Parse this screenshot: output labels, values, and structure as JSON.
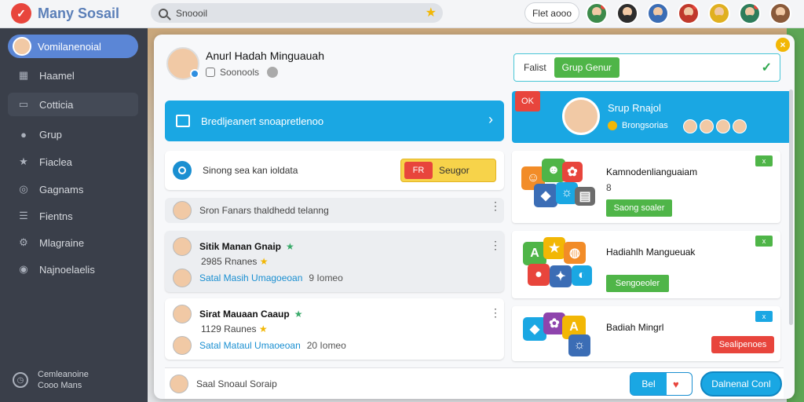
{
  "app": {
    "title": "Many Sosail"
  },
  "search": {
    "value": "Snoooil"
  },
  "top": {
    "button_label": "Flet aooo"
  },
  "sidebar": {
    "items": [
      {
        "label": "Vomilanenoial"
      },
      {
        "label": "Haamel"
      },
      {
        "label": "Cotticia"
      },
      {
        "label": "Grup"
      },
      {
        "label": "Fiaclea"
      },
      {
        "label": "Gagnams"
      },
      {
        "label": "Fientns"
      },
      {
        "label": "Mlagraine"
      },
      {
        "label": "Najnoelaelis"
      }
    ],
    "footer_line1": "Cemleanoine",
    "footer_line2": "Cooo Mans"
  },
  "modal": {
    "profile_name": "Anurl Hadah Minguauah",
    "profile_sub": "Soonools",
    "filter_label": "Falist",
    "filter_chip": "Grup Genur",
    "banner_text": "Bredljeanert snoapretlenoo",
    "row_a_text": "Sinong sea kan ioldata",
    "row_a_badge": "FR",
    "row_a_button": "Seugor",
    "row_b_text": "Sron Fanars thaldhedd telanng",
    "groups": [
      {
        "title": "Sitik Manan Gnaip",
        "count": "2985",
        "count_label": "Rnanes",
        "link": "Satal Masih Umagoeoan",
        "meta": "9 Iomeo"
      },
      {
        "title": "Sirat Mauaan Caaup",
        "count": "1129",
        "count_label": "Raunes",
        "link": "Satal Mataul Umaoeoan",
        "meta": "20 Iomeo"
      }
    ],
    "bottom_text": "Saal Snoaul Soraip",
    "bottom_outline_label": "Bel",
    "bottom_primary_label": "Dalnenal Conl",
    "rp_ok": "OK",
    "rp_title": "Srup Rnajol",
    "rp_sub": "Brongsorias",
    "games": [
      {
        "title": "Kamnodenlianguaiam",
        "sub": "8",
        "button": "Saong soaler",
        "x": "x"
      },
      {
        "title": "Hadiahlh Mangueuak",
        "sub": "",
        "button": "Sengoeoler",
        "x": "x"
      },
      {
        "title": "Badiah Mingrl",
        "sub": "",
        "button": "Sealipenoes",
        "x": "x"
      }
    ]
  },
  "colors": {
    "accent": "#1aa7e3",
    "green": "#4fb548",
    "red": "#e8453c",
    "sidebar_bg": "#3a3f4a"
  },
  "icons": [
    "logo-icon",
    "search-icon",
    "star-icon",
    "home-icon",
    "chat-icon",
    "group-icon",
    "star-icon",
    "gamepad-icon",
    "list-icon",
    "settings-icon",
    "info-icon",
    "clock-icon",
    "check-icon",
    "chevron-right-icon",
    "close-icon",
    "kebab-icon"
  ]
}
